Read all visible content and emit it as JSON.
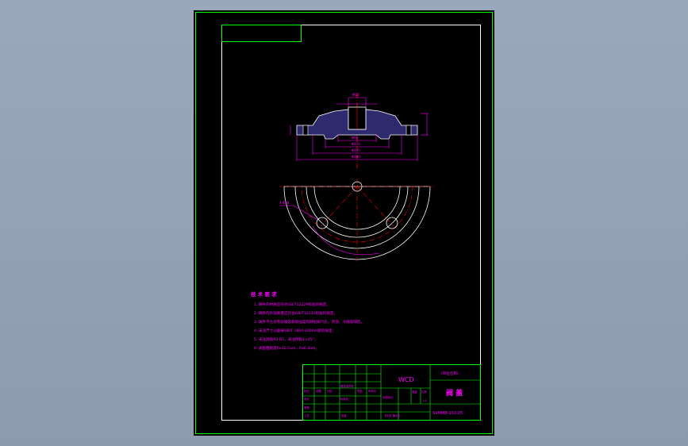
{
  "drawing": {
    "title_block": {
      "material": "WCD",
      "company": "(单位名称)",
      "part_name": "阀 盖",
      "drawing_no": "SVMMB-102-05",
      "scale": "1:1",
      "sheet_info": "共1张  第1张",
      "labels_top": [
        "标记",
        "处数",
        "分区",
        "更改文件号",
        "签名",
        "年月日"
      ],
      "labels_bottom": [
        "设计",
        "标准化",
        "阶段标记",
        "重量",
        "比例",
        "审核",
        "工艺",
        "批准"
      ]
    },
    "technical_requirements": {
      "heading": "技 术 要 求",
      "items": [
        "1. 铸件的材质应符合GB/T12229标准的规定。",
        "2. 铸件的外观质量应符合GB/T12231标准的规定。",
        "3. 铸件不允许有砂眼及影响强度的缺陷如气孔、夹渣、冷隔等缺陷。",
        "4. 未注尺寸公差按GB/T 1804-2000m级的规定。",
        "5. 未注圆角R3-R5，未注倒角1×45°。",
        "6. 表面粗糙度Ra12.5um，Ra6.3um。"
      ]
    },
    "annotations": {
      "leader_label": "4-Φ18",
      "top_dims": [
        "M16",
        "Φ60",
        "Φ180",
        "Φ145",
        "Φ110"
      ]
    }
  },
  "colors": {
    "background": "#9aa8bb",
    "sheet": "#000000",
    "outer_border": "#00ff00",
    "inner_frame": "#ffffff",
    "dimension": "#ff00ff",
    "centerline": "#ff0000",
    "part_fill": "#2e2a6e",
    "table_lines": "#00ff00",
    "text_yellow": "#ffff00"
  }
}
